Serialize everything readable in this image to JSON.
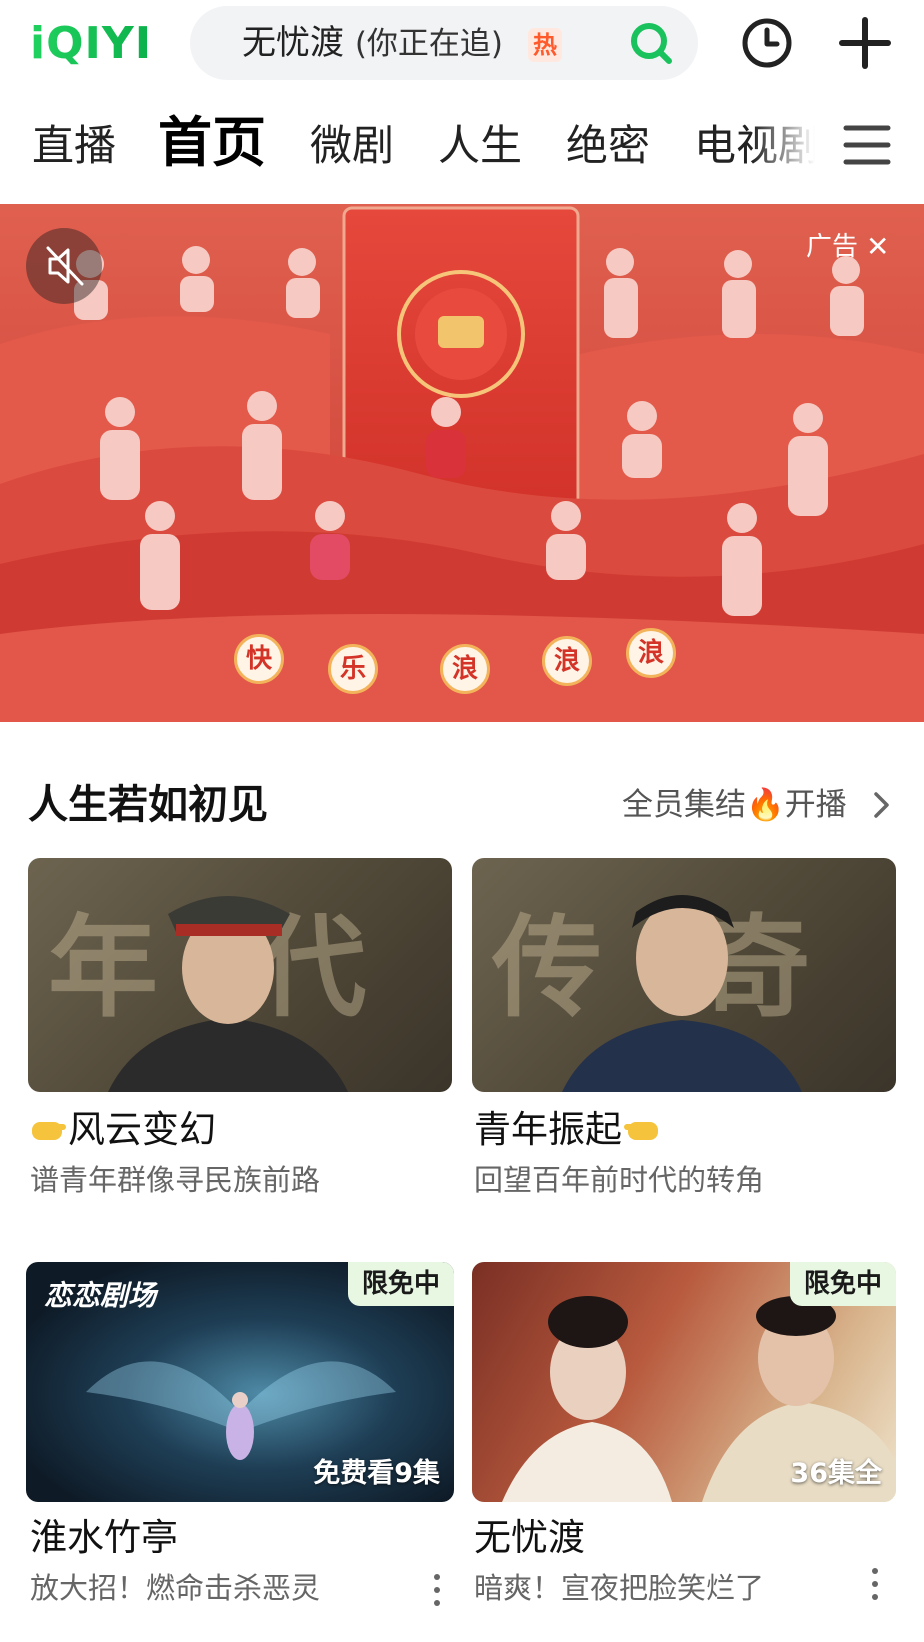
{
  "header": {
    "logo": "iQIYI",
    "search_text": "无忧渡",
    "search_sub": "(你正在追)",
    "hot_badge": "热"
  },
  "nav": {
    "tabs": [
      "直播",
      "首页",
      "微剧",
      "人生",
      "绝密",
      "电视剧"
    ],
    "active_index": 1
  },
  "banner": {
    "ad_label": "广告",
    "close_glyph": "✕",
    "lanterns": [
      "快",
      "乐",
      "浪",
      "浪",
      "浪"
    ]
  },
  "section": {
    "title": "人生若如初见",
    "more_prefix": "全员集结",
    "more_suffix": "开播"
  },
  "cards": [
    {
      "title": "风云变幻",
      "subtitle": "谱青年群像寻民族前路",
      "thumb_text": "年 代"
    },
    {
      "title": "青年振起",
      "subtitle": "回望百年前时代的转角",
      "thumb_text": "传 奇"
    },
    {
      "title": "淮水竹亭",
      "subtitle": "放大招！燃命击杀恶灵",
      "badge": "限免中",
      "episodes": "免费看9集",
      "brand": "恋恋剧场"
    },
    {
      "title": "无忧渡",
      "subtitle": "暗爽！宣夜把脸笑烂了",
      "badge": "限免中",
      "episodes": "36集全"
    }
  ],
  "colors": {
    "brand_green": "#00be06",
    "banner_red": "#d8493c",
    "free_badge_bg": "#e7f7e2"
  }
}
